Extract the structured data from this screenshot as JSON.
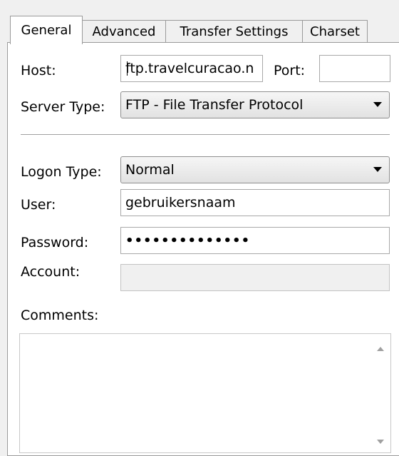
{
  "tabs": [
    {
      "label": "General",
      "active": true
    },
    {
      "label": "Advanced",
      "active": false
    },
    {
      "label": "Transfer Settings",
      "active": false
    },
    {
      "label": "Charset",
      "active": false
    }
  ],
  "host": {
    "label": "Host:",
    "value": "ftp.travelcuracao.n"
  },
  "port": {
    "label": "Port:",
    "value": ""
  },
  "server_type": {
    "label": "Server Type:",
    "value": "FTP - File Transfer Protocol"
  },
  "logon_type": {
    "label": "Logon Type:",
    "value": "Normal"
  },
  "user": {
    "label": "User:",
    "value": "gebruikersnaam"
  },
  "password": {
    "label": "Password:",
    "value": "••••••••••••••"
  },
  "account": {
    "label": "Account:",
    "value": ""
  },
  "comments": {
    "label": "Comments:",
    "value": ""
  }
}
